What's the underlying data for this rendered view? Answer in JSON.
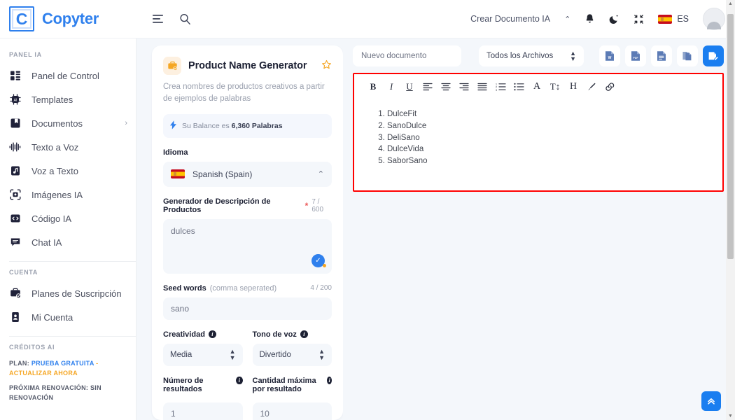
{
  "header": {
    "brand_initial": "C",
    "brand_name": "Copyter",
    "menu_icon": "menu-lines-icon",
    "search_icon": "search-icon",
    "create_doc_label": "Crear Documento IA",
    "caret": "⌃",
    "bell_icon": "bell-icon",
    "theme_icon": "moon-icon",
    "fullscreen_icon": "collapse-icon",
    "lang_code": "ES",
    "avatar": "user-avatar"
  },
  "sidebar": {
    "section_panel_label": "PANEL IA",
    "items": [
      {
        "label": "Panel de Control",
        "icon": "dashboard-icon",
        "chevron": ""
      },
      {
        "label": "Templates",
        "icon": "ai-chip-icon",
        "chevron": ""
      },
      {
        "label": "Documentos",
        "icon": "document-bookmark-icon",
        "chevron": "›"
      },
      {
        "label": "Texto a Voz",
        "icon": "waveform-icon",
        "chevron": ""
      },
      {
        "label": "Voz a Texto",
        "icon": "audio-file-icon",
        "chevron": ""
      },
      {
        "label": "Imágenes IA",
        "icon": "camera-frame-icon",
        "chevron": ""
      },
      {
        "label": "Código IA",
        "icon": "code-icon",
        "chevron": ""
      },
      {
        "label": "Chat IA",
        "icon": "chat-icon",
        "chevron": ""
      }
    ],
    "section_account_label": "CUENTA",
    "account_items": [
      {
        "label": "Planes de Suscripción",
        "icon": "briefcase-check-icon"
      },
      {
        "label": "Mi Cuenta",
        "icon": "id-card-icon"
      }
    ],
    "section_credits_label": "CRÉDITOS AI",
    "plan_prefix": "PLAN:",
    "plan_name": "PRUEBA GRATUITA",
    "plan_sep": "-",
    "plan_upgrade": "ACTUALIZAR AHORA",
    "renewal_line": "PRÓXIMA RENOVACIÓN: SIN RENOVACIÓN"
  },
  "template_panel": {
    "icon": "briefcase-star-icon",
    "title": "Product Name Generator",
    "star_icon": "star-outline-icon",
    "description": "Crea nombres de productos creativos a partir de ejemplos de palabras",
    "balance_icon": "bolt-icon",
    "balance_prefix": "Su Balance es",
    "balance_value": "6,360 Palabras",
    "language_label": "Idioma",
    "language_value": "Spanish (Spain)",
    "language_flag": "spain-flag-icon",
    "language_chevron": "⌃",
    "prompt_label": "Generador de Descripción de Productos",
    "prompt_required": "*",
    "prompt_counter": "7 / 600",
    "prompt_value": "dulces",
    "grammar_icon": "grammarly-check-icon",
    "seed_label": "Seed words",
    "seed_label_muted": "(comma seperated)",
    "seed_counter": "4 / 200",
    "seed_value": "sano",
    "creativity_label": "Creatividad",
    "creativity_value": "Media",
    "tone_label": "Tono de voz",
    "tone_value": "Divertido",
    "results_label": "Número de resultados",
    "results_value": "1",
    "maxlen_label": "Cantidad máxima por resultado",
    "maxlen_value": "10",
    "info_glyph": "i"
  },
  "editor": {
    "doc_name_value": "Nuevo documento",
    "filter_value": "Todos los Archivos",
    "export_buttons": [
      {
        "name": "export-word-button",
        "glyph": "W"
      },
      {
        "name": "export-pdf-button",
        "glyph": "PDF"
      },
      {
        "name": "export-text-button",
        "glyph": ""
      },
      {
        "name": "copy-document-button",
        "glyph": ""
      },
      {
        "name": "save-document-button",
        "glyph": ""
      }
    ],
    "toolbar": [
      {
        "name": "bold-icon",
        "glyph": "B"
      },
      {
        "name": "italic-icon",
        "glyph": "I"
      },
      {
        "name": "underline-icon",
        "glyph": "U"
      },
      {
        "name": "align-left-icon",
        "glyph": "≡"
      },
      {
        "name": "align-center-icon",
        "glyph": "≡"
      },
      {
        "name": "align-right-icon",
        "glyph": "≡"
      },
      {
        "name": "align-justify-icon",
        "glyph": "≡"
      },
      {
        "name": "ordered-list-icon",
        "glyph": "≡"
      },
      {
        "name": "unordered-list-icon",
        "glyph": "≡"
      },
      {
        "name": "font-color-icon",
        "glyph": "A"
      },
      {
        "name": "font-size-icon",
        "glyph": "T↕"
      },
      {
        "name": "heading-icon",
        "glyph": "H"
      },
      {
        "name": "highlight-icon",
        "glyph": "✒"
      },
      {
        "name": "link-icon",
        "glyph": "⚭"
      }
    ],
    "document_items": [
      "DulceFit",
      "SanoDulce",
      "DeliSano",
      "DulceVida",
      "SaborSano"
    ],
    "scroll_top_icon": "chevron-double-up-icon",
    "highlight_color": "#ff0000"
  },
  "colors": {
    "accent": "#2f80ed",
    "button_blue": "#1a7ef0",
    "orange": "#f5a623",
    "panel_bg": "#f4f7fb",
    "highlight": "#ff0000"
  }
}
